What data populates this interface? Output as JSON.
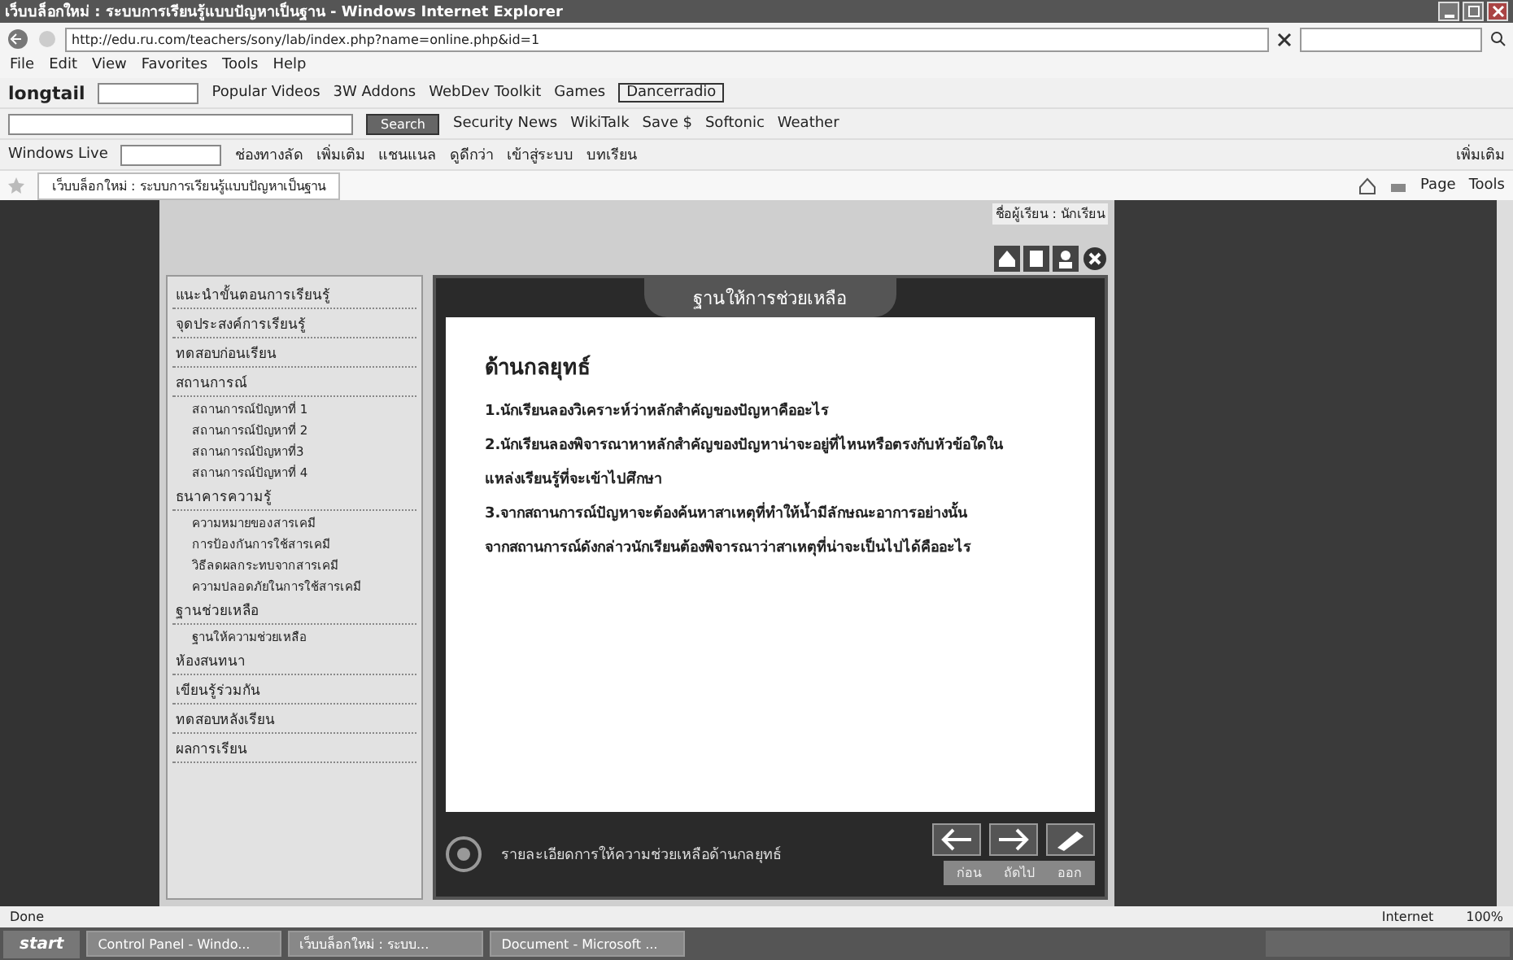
{
  "window": {
    "title": "เว็บบล็อกใหม่ : ระบบการเรียนรู้แบบปัญหาเป็นฐาน - Windows Internet Explorer"
  },
  "address_bar": {
    "url": "http://edu.ru.com/teachers/sony/lab/index.php?name=online.php&id=1"
  },
  "menu": [
    "File",
    "Edit",
    "View",
    "Favorites",
    "Tools",
    "Help"
  ],
  "toolbar_1": {
    "brand": "longtail",
    "items": [
      "Popular Videos",
      "3W Addons",
      "WebDev Toolkit",
      "Games"
    ],
    "radio": "Dancerradio"
  },
  "toolbar_2": {
    "search_button": "Search",
    "items": [
      "Security News",
      "WikiTalk",
      "Save $",
      "Softonic",
      "Weather"
    ]
  },
  "toolbar_3": {
    "brand": "Windows Live",
    "links": [
      "ช่องทางลัด",
      "เพิ่มเติม",
      "แชนแนล",
      "ดูดีกว่า",
      "เข้าสู่ระบบ",
      "บทเรียน"
    ],
    "right": "เพิ่มเติม"
  },
  "tab": {
    "label": "เว็บบล็อกใหม่ : ระบบการเรียนรู้แบบปัญหาเป็นฐาน"
  },
  "command_bar": [
    "Page",
    "Tools"
  ],
  "page": {
    "user": "ชื่อผู้เรียน : นักเรียน",
    "sidebar": [
      {
        "label": "แนะนำขั้นตอนการเรียนรู้"
      },
      {
        "label": "จุดประสงค์การเรียนรู้"
      },
      {
        "label": "ทดสอบก่อนเรียน"
      },
      {
        "label": "สถานการณ์",
        "children": [
          {
            "label": "สถานการณ์ปัญหาที่ 1"
          },
          {
            "label": "สถานการณ์ปัญหาที่ 2"
          },
          {
            "label": "สถานการณ์ปัญหาที่3"
          },
          {
            "label": "สถานการณ์ปัญหาที่ 4"
          }
        ]
      },
      {
        "label": "ธนาคารความรู้",
        "children": [
          {
            "label": "ความหมายของสารเคมี"
          },
          {
            "label": "การป้องกันการใช้สารเคมี"
          },
          {
            "label": "วิธีลดผลกระทบจากสารเคมี"
          },
          {
            "label": "ความปลอดภัยในการใช้สารเคมี"
          }
        ]
      },
      {
        "label": "ฐานช่วยเหลือ",
        "children": [
          {
            "label": "ฐานให้ความช่วยเหลือ"
          }
        ]
      },
      {
        "label": "ห้องสนทนา"
      },
      {
        "label": "เขียนรู้ร่วมกัน"
      },
      {
        "label": "ทดสอบหลังเรียน"
      },
      {
        "label": "ผลการเรียน"
      }
    ],
    "panel": {
      "title": "ฐานให้การช่วยเหลือ",
      "heading": "ด้านกลยุทธ์",
      "lines": [
        "1.นักเรียนลองวิเคราะห์ว่าหลักสำคัญของปัญหาคืออะไร",
        "2.นักเรียนลองพิจารณาหาหลักสำคัญของปัญหาน่าจะอยู่ที่ไหนหรือตรงกับหัวข้อใดใน",
        "แหล่งเรียนรู้ที่จะเข้าไปศึกษา",
        "3.จากสถานการณ์ปัญหาจะต้องค้นหาสาเหตุที่ทำให้น้ำมีลักษณะอาการอย่างนั้น",
        "จากสถานการณ์ดังกล่าวนักเรียนต้องพิจารณาว่าสาเหตุที่น่าจะเป็นไปได้คืออะไร"
      ],
      "footer": "รายละเอียดการให้ความช่วยเหลือด้านกลยุทธ์",
      "nav_labels": [
        "ก่อน",
        "ถัดไป",
        "ออก"
      ]
    }
  },
  "status_bar": {
    "status": "Done",
    "zone": "Internet",
    "zoom": "100%"
  },
  "taskbar": {
    "start": "start",
    "tasks": [
      "Control Panel - Windo...",
      "เว็บบล็อกใหม่ : ระบบ...",
      "Document - Microsoft ..."
    ]
  }
}
